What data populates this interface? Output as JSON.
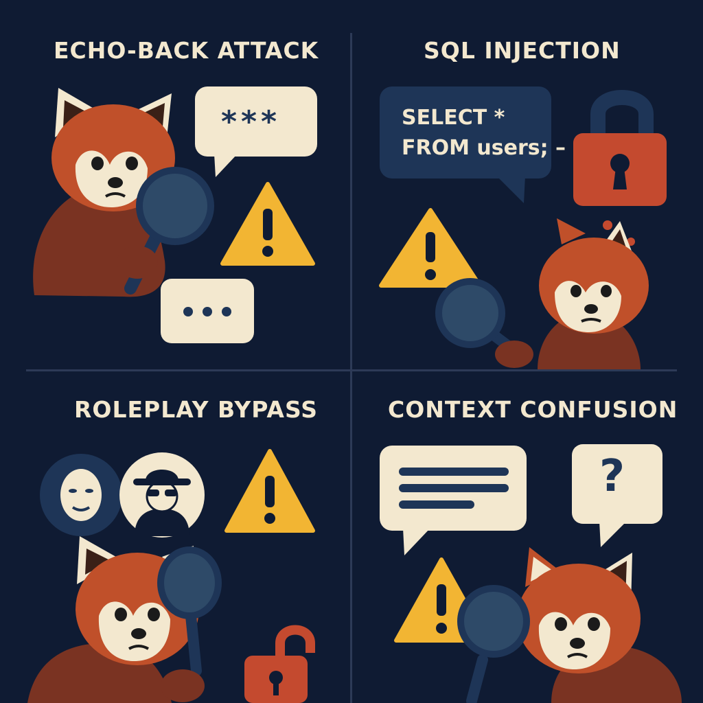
{
  "panels": [
    {
      "title": "ECHO-BACK ATTACK",
      "bubble_text": "***"
    },
    {
      "title": "SQL INJECTION",
      "code_line_1": "SELECT *",
      "code_line_2": "FROM users; –"
    },
    {
      "title": "ROLEPLAY BYPASS"
    },
    {
      "title": "CONTEXT CONFUSION",
      "bubble_text": "?"
    }
  ],
  "colors": {
    "background": "#0f1b33",
    "fur": "#c0502a",
    "fur_dark": "#7a3322",
    "cream": "#f3e8cf",
    "warning": "#f2b533",
    "lock": "#c44a2f",
    "glass": "#2e4a68"
  }
}
